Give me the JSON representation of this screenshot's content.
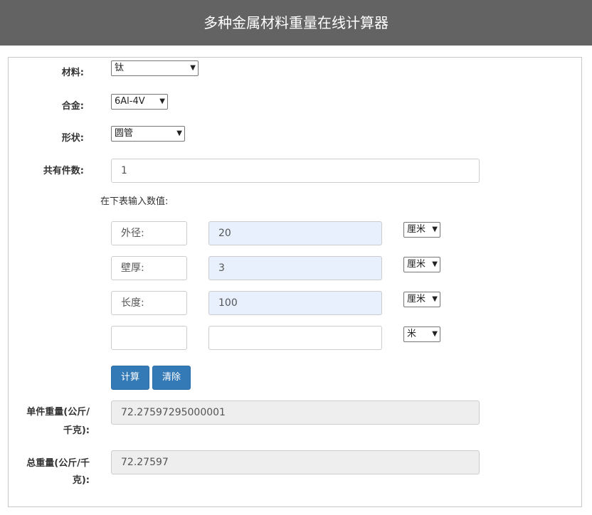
{
  "header": {
    "title": "多种金属材料重量在线计算器"
  },
  "form": {
    "material_label": "材料:",
    "material_value": "钛",
    "alloy_label": "合金:",
    "alloy_value": "6Al-4V",
    "shape_label": "形状:",
    "shape_value": "圆管",
    "count_label": "共有件数:",
    "count_value": "1",
    "hint": "在下表输入数值:"
  },
  "dimensions": [
    {
      "name": "外径:",
      "value": "20",
      "unit": "厘米"
    },
    {
      "name": "壁厚:",
      "value": "3",
      "unit": "厘米"
    },
    {
      "name": "长度:",
      "value": "100",
      "unit": "厘米"
    },
    {
      "name": "",
      "value": "",
      "unit": "米"
    }
  ],
  "buttons": {
    "calculate": "计算",
    "clear": "清除"
  },
  "results": {
    "unit_weight_label_line1": "单件重量(公斤/",
    "unit_weight_label_line2": "千克):",
    "unit_weight_value": "72.27597295000001",
    "total_weight_label_line1": "总重量(公斤/千",
    "total_weight_label_line2": "克):",
    "total_weight_value": "72.27597"
  },
  "icons": {
    "select_arrow": "chevron-down-icon"
  }
}
